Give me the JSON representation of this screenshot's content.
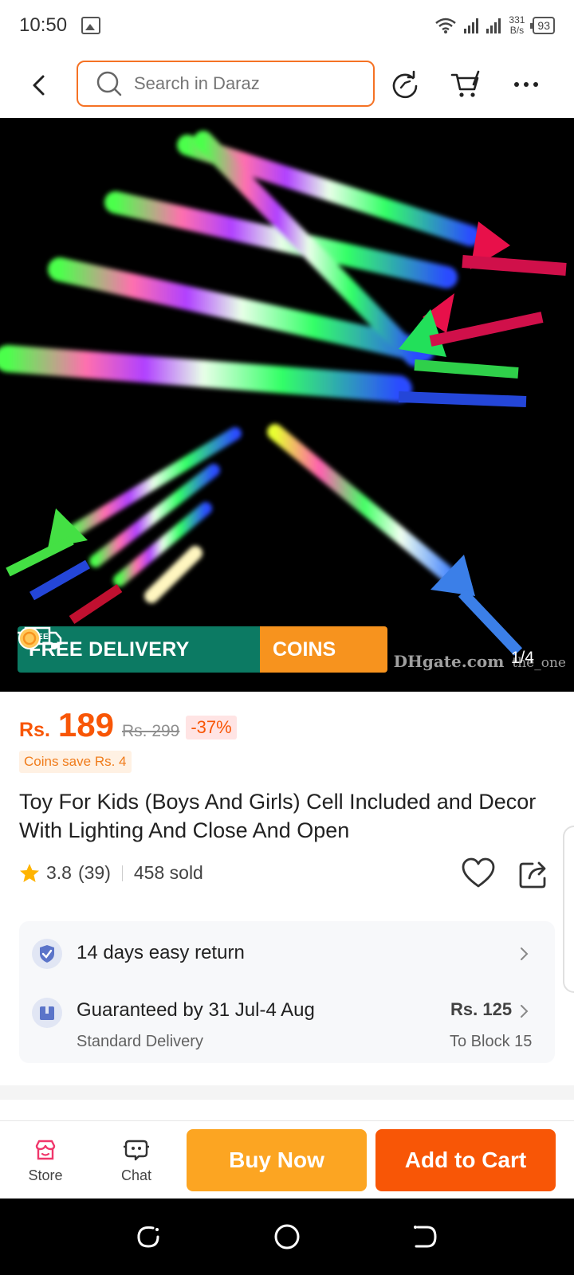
{
  "status_bar": {
    "time": "10:50",
    "net_speed_value": "331",
    "net_speed_unit": "B/s",
    "battery": "93",
    "icons": [
      "gallery-icon",
      "wifi-icon",
      "signal-icon",
      "battery-icon"
    ]
  },
  "header": {
    "search_placeholder": "Search in Daraz",
    "icons": [
      "back-icon",
      "search-icon",
      "refresh-icon",
      "cart-icon",
      "more-icon"
    ]
  },
  "gallery": {
    "counter": "1/4",
    "watermark_brand": "DHgate.com",
    "watermark_user": "the_one",
    "banner_free_tag": "FREE",
    "banner_free_delivery": "FREE DELIVERY",
    "banner_coins": "COINS"
  },
  "price": {
    "currency": "Rs.",
    "current": "189",
    "original": "Rs. 299",
    "discount": "-37%",
    "coins_save": "Coins save Rs. 4"
  },
  "product": {
    "title": "Toy For Kids (Boys And Girls) Cell Included and Decor With Lighting And Close And Open",
    "rating": "3.8",
    "rating_count": "(39)",
    "sold": "458 sold"
  },
  "service": {
    "return_text": "14 days easy return",
    "delivery_text": "Guaranteed by 31 Jul-4 Aug",
    "delivery_type": "Standard Delivery",
    "delivery_fee": "Rs. 125",
    "delivery_location": "To Block 15"
  },
  "action_bar": {
    "store_label": "Store",
    "chat_label": "Chat",
    "buy_now_label": "Buy Now",
    "add_to_cart_label": "Add to Cart"
  },
  "colors": {
    "brand_orange": "#f85606",
    "buy_now": "#fca522",
    "free_delivery_green": "#0c7a63",
    "coins_orange": "#f7931e"
  }
}
